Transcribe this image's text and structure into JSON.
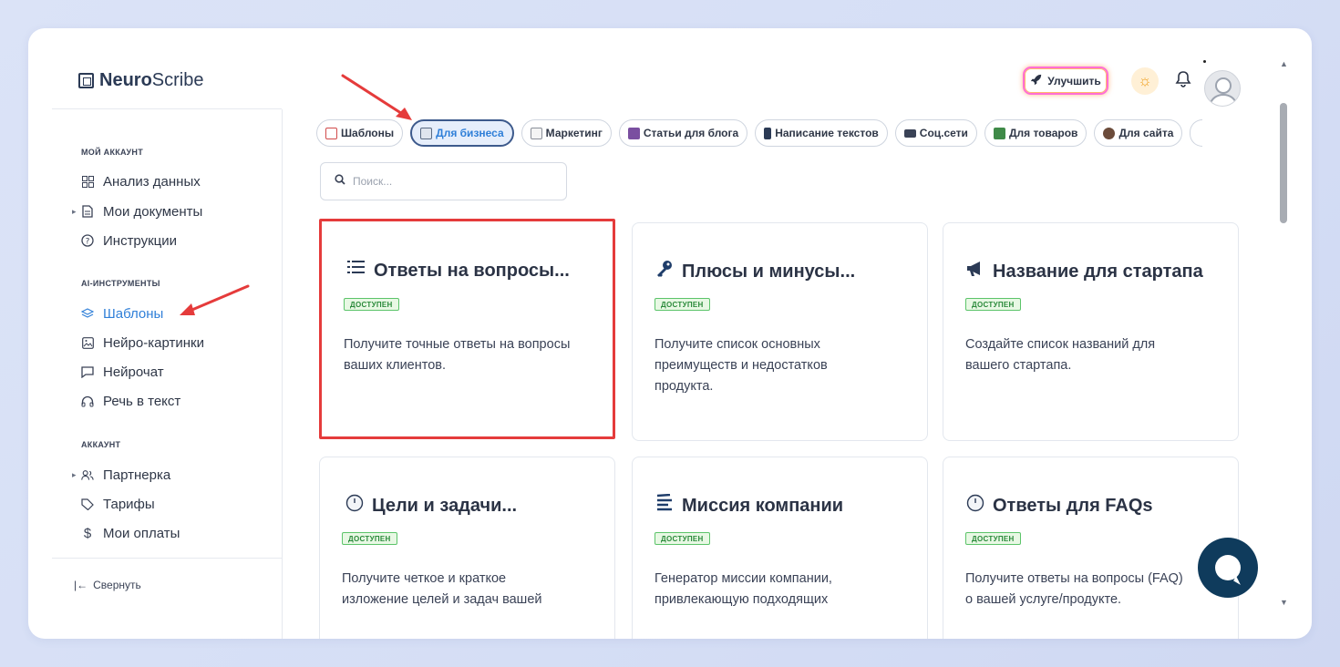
{
  "app": {
    "logo_bold": "Neuro",
    "logo_light": "Scribe"
  },
  "header": {
    "upgrade_label": "Улучшить",
    "theme_icon": "sun-icon",
    "bell_icon": "bell-icon"
  },
  "sidebar": {
    "sections": [
      {
        "label": "МОЙ АККАУНТ",
        "items": [
          {
            "label": "Анализ данных",
            "icon": "grid-icon"
          },
          {
            "label": "Мои документы",
            "icon": "document-icon",
            "caret": true
          },
          {
            "label": "Инструкции",
            "icon": "help-circle-icon"
          }
        ]
      },
      {
        "label": "AI-ИНСТРУМЕНТЫ",
        "items": [
          {
            "label": "Шаблоны",
            "icon": "layers-icon",
            "active": true
          },
          {
            "label": "Нейро-картинки",
            "icon": "image-icon"
          },
          {
            "label": "Нейрочат",
            "icon": "chat-icon"
          },
          {
            "label": "Речь в текст",
            "icon": "headphones-icon"
          }
        ]
      },
      {
        "label": "АККАУНТ",
        "items": [
          {
            "label": "Партнерка",
            "icon": "users-icon",
            "caret": true
          },
          {
            "label": "Тарифы",
            "icon": "tag-icon"
          },
          {
            "label": "Мои оплаты",
            "icon": "dollar-icon"
          }
        ]
      }
    ],
    "collapse_label": "Свернуть"
  },
  "categories": [
    {
      "label": "Шаблоны",
      "icon_color": "#d14b4b"
    },
    {
      "label": "Для бизнеса",
      "icon_color": "#5a6b84",
      "active": true
    },
    {
      "label": "Маркетинг",
      "icon_color": "#8a8f99"
    },
    {
      "label": "Статьи для блога",
      "icon_color": "#7a4fa0"
    },
    {
      "label": "Написание текстов",
      "icon_color": "#2b3a55"
    },
    {
      "label": "Соц.сети",
      "icon_color": "#3a4256"
    },
    {
      "label": "Для товаров",
      "icon_color": "#3f8a48"
    },
    {
      "label": "Для сайта",
      "icon_color": "#6b4b3a"
    }
  ],
  "search": {
    "placeholder": "Поиск..."
  },
  "cards": [
    {
      "title": "Ответы на вопросы...",
      "icon": "list-icon",
      "badge": "ДОСТУПЕН",
      "desc": "Получите точные ответы на вопросы ваших клиентов.",
      "highlight": true
    },
    {
      "title": "Плюсы и минусы...",
      "icon": "key-icon",
      "badge": "ДОСТУПЕН",
      "desc": "Получите список основных преимуществ и недостатков продукта."
    },
    {
      "title": "Название для стартапа",
      "icon": "megaphone-icon",
      "badge": "ДОСТУПЕН",
      "desc": "Создайте список названий для вашего стартапа."
    },
    {
      "title": "Цели и задачи...",
      "icon": "clock-icon",
      "badge": "ДОСТУПЕН",
      "desc": "Получите четкое и краткое изложение целей и задач вашей"
    },
    {
      "title": "Миссия компании",
      "icon": "lines-icon",
      "badge": "ДОСТУПЕН",
      "desc": "Генератор миссии компании, привлекающую подходящих"
    },
    {
      "title": "Ответы для FAQs",
      "icon": "clock-icon",
      "badge": "ДОСТУПЕН",
      "desc": "Получите ответы на вопросы (FAQ) о вашей услуге/продукте."
    }
  ],
  "annotation_color": "#e53b3b"
}
